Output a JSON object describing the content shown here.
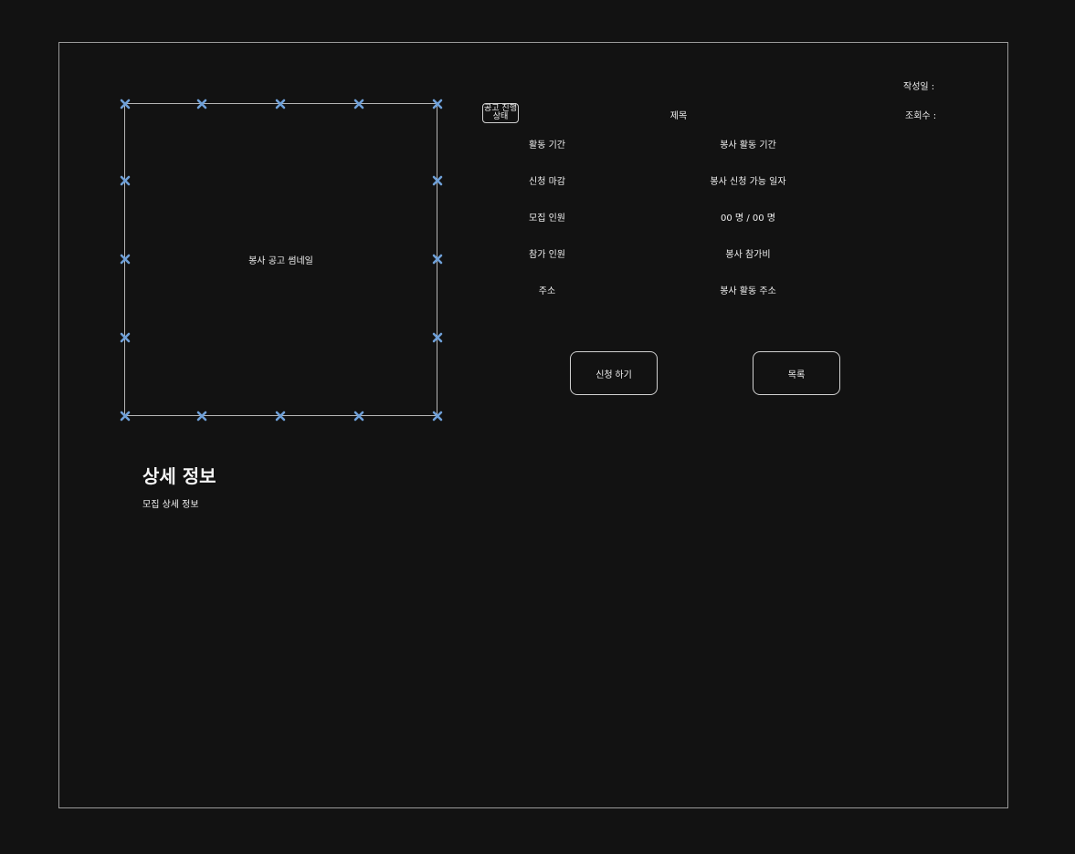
{
  "colors": {
    "background": "#121212",
    "frame": "#9a9a9a",
    "handle": "#6fa0d8",
    "text": "#f0f0f0"
  },
  "thumbnail": {
    "label": "봉사 공고 썸네일",
    "handle_icon": "x-handle-icon"
  },
  "header": {
    "status_badge": "공고 진행 상태",
    "title": "제목",
    "created_label": "작성일 :",
    "views_label": "조회수 :"
  },
  "details": [
    {
      "label": "활동 기간",
      "value": "봉사 활동 기간"
    },
    {
      "label": "신청 마감",
      "value": "봉사 신청 가능 일자"
    },
    {
      "label": "모집 인원",
      "value": "00 명 / 00 명"
    },
    {
      "label": "참가 인원",
      "value": "봉사 참가비"
    },
    {
      "label": "주소",
      "value": "봉사 활동 주소"
    }
  ],
  "buttons": {
    "apply": "신청 하기",
    "list": "목록"
  },
  "detail_section": {
    "title": "상세 정보",
    "body": "모집 상세 정보"
  }
}
